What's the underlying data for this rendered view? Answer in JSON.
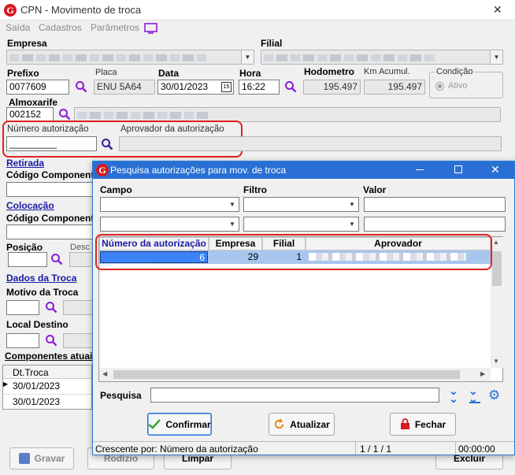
{
  "window": {
    "title": "CPN - Movimento de troca",
    "logo_letter": "G",
    "close_glyph": "✕"
  },
  "menu": [
    "Saída",
    "Cadastros",
    "Parâmetros"
  ],
  "form": {
    "empresa_label": "Empresa",
    "filial_label": "Filial",
    "prefixo_label": "Prefixo",
    "prefixo_value": "0077609",
    "placa_label": "Placa",
    "placa_value": "ENU 5A64",
    "data_label": "Data",
    "data_value": "30/01/2023",
    "hora_label": "Hora",
    "hora_value": "16:22",
    "hodometro_label": "Hodometro",
    "hodometro_value": "195.497",
    "km_label": "Km Acumul.",
    "km_value": "195.497",
    "condicao_label": "Condição",
    "ativo_label": "Ativo",
    "almoxarife_label": "Almoxarife",
    "almoxarife_value": "002152",
    "numero_aut_label": "Número autorização",
    "numero_aut_value": "_________",
    "aprovador_label": "Aprovador da autorização",
    "retirada_label": "Retirada",
    "codigo_comp_label": "Código Component",
    "colocacao_label": "Colocação",
    "codigo_comp2_label": "Código Component",
    "posicao_label": "Posição",
    "desc_label": "Desc",
    "dados_troca_label": "Dados da Troca",
    "motivo_label": "Motivo da Troca",
    "local_label": "Local Destino",
    "componentes_label": "Componentes atuai",
    "dt_troca_header": "Dt.Troca",
    "dt_rows": [
      "30/01/2023",
      "30/01/2023"
    ]
  },
  "bottom_buttons": {
    "gravar": "Gravar",
    "rodizio": "Rodízio",
    "limpar": "Limpar",
    "excluir": "Excluir"
  },
  "dialog": {
    "title": "Pesquisa autorizações para mov. de troca",
    "campo_label": "Campo",
    "filtro_label": "Filtro",
    "valor_label": "Valor",
    "columns": [
      "Número da autorização",
      "Empresa",
      "Filial",
      "Aprovador"
    ],
    "row": {
      "numero": "6",
      "empresa": "29",
      "filial": "1"
    },
    "pesquisa_label": "Pesquisa",
    "confirmar_label": "Confirmar",
    "atualizar_label": "Atualizar",
    "fechar_label": "Fechar",
    "status_order": "Crescente por: Número da autorização",
    "status_pages": "1 / 1 / 1",
    "status_time": "00:00:00"
  }
}
